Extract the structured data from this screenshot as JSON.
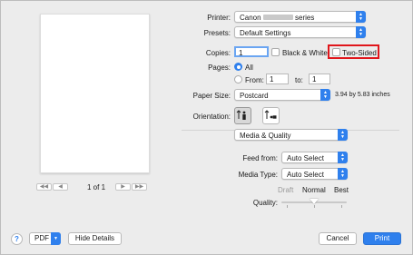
{
  "printer": {
    "label": "Printer:",
    "value_prefix": "Canon",
    "value_suffix": "series"
  },
  "presets": {
    "label": "Presets:",
    "value": "Default Settings"
  },
  "copies": {
    "label": "Copies:",
    "value": "1"
  },
  "black_white": {
    "label": "Black & White"
  },
  "two_sided": {
    "label": "Two-Sided"
  },
  "pages": {
    "label": "Pages:",
    "all": "All",
    "from_label": "From:",
    "from_value": "1",
    "to_label": "to:",
    "to_value": "1"
  },
  "paper_size": {
    "label": "Paper Size:",
    "value": "Postcard",
    "dimensions": "3.94 by 5.83 inches"
  },
  "orientation": {
    "label": "Orientation:"
  },
  "section": {
    "value": "Media & Quality"
  },
  "feed_from": {
    "label": "Feed from:",
    "value": "Auto Select"
  },
  "media_type": {
    "label": "Media Type:",
    "value": "Auto Select"
  },
  "quality": {
    "label": "Quality:",
    "draft": "Draft",
    "normal": "Normal",
    "best": "Best",
    "level_fraction": 0.5
  },
  "preview": {
    "page_indicator": "1 of 1",
    "first": "◀◀",
    "prev": "◀",
    "next": "▶",
    "last": "▶▶"
  },
  "footer": {
    "help": "?",
    "pdf": "PDF",
    "hide_details": "Hide Details",
    "cancel": "Cancel",
    "print": "Print"
  },
  "colors": {
    "accent": "#2f80ed",
    "highlight": "#e0161b"
  }
}
